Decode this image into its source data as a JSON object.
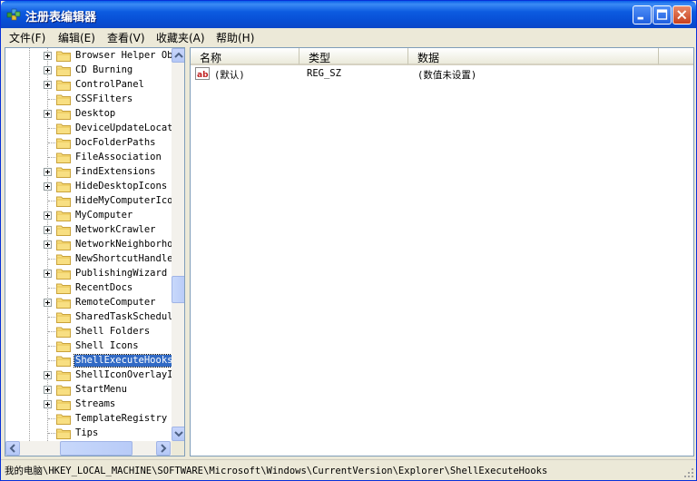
{
  "window": {
    "title": "注册表编辑器",
    "icon": "regedit-icon"
  },
  "menu": [
    {
      "label": "文件(F)"
    },
    {
      "label": "编辑(E)"
    },
    {
      "label": "查看(V)"
    },
    {
      "label": "收藏夹(A)"
    },
    {
      "label": "帮助(H)"
    }
  ],
  "tree": {
    "items": [
      {
        "label": "Browser Helper Ob",
        "expandable": true
      },
      {
        "label": "CD Burning",
        "expandable": true
      },
      {
        "label": "ControlPanel",
        "expandable": true
      },
      {
        "label": "CSSFilters",
        "expandable": false
      },
      {
        "label": "Desktop",
        "expandable": true
      },
      {
        "label": "DeviceUpdateLocat",
        "expandable": false
      },
      {
        "label": "DocFolderPaths",
        "expandable": false
      },
      {
        "label": "FileAssociation",
        "expandable": false
      },
      {
        "label": "FindExtensions",
        "expandable": true
      },
      {
        "label": "HideDesktopIcons",
        "expandable": true
      },
      {
        "label": "HideMyComputerIco",
        "expandable": false
      },
      {
        "label": "MyComputer",
        "expandable": true
      },
      {
        "label": "NetworkCrawler",
        "expandable": true
      },
      {
        "label": "NetworkNeighborho",
        "expandable": true
      },
      {
        "label": "NewShortcutHandle",
        "expandable": false
      },
      {
        "label": "PublishingWizard",
        "expandable": true
      },
      {
        "label": "RecentDocs",
        "expandable": false
      },
      {
        "label": "RemoteComputer",
        "expandable": true
      },
      {
        "label": "SharedTaskSchedul",
        "expandable": false
      },
      {
        "label": "Shell Folders",
        "expandable": false
      },
      {
        "label": "Shell Icons",
        "expandable": false
      },
      {
        "label": "ShellExecuteHooks",
        "expandable": false,
        "selected": true
      },
      {
        "label": "ShellIconOverlayI",
        "expandable": true
      },
      {
        "label": "StartMenu",
        "expandable": true
      },
      {
        "label": "Streams",
        "expandable": true
      },
      {
        "label": "TemplateRegistry",
        "expandable": false
      },
      {
        "label": "Tips",
        "expandable": false
      }
    ]
  },
  "values": {
    "columns": [
      "名称",
      "类型",
      "数据"
    ],
    "rows": [
      {
        "name": "(默认)",
        "type": "REG_SZ",
        "data": "(数值未设置)",
        "icon": "string-value-icon"
      }
    ]
  },
  "status": {
    "path": "我的电脑\\HKEY_LOCAL_MACHINE\\SOFTWARE\\Microsoft\\Windows\\CurrentVersion\\Explorer\\ShellExecuteHooks"
  },
  "colors": {
    "titlebar": "#0a5fe8",
    "selection": "#316ac5",
    "chrome": "#ece9d8"
  }
}
